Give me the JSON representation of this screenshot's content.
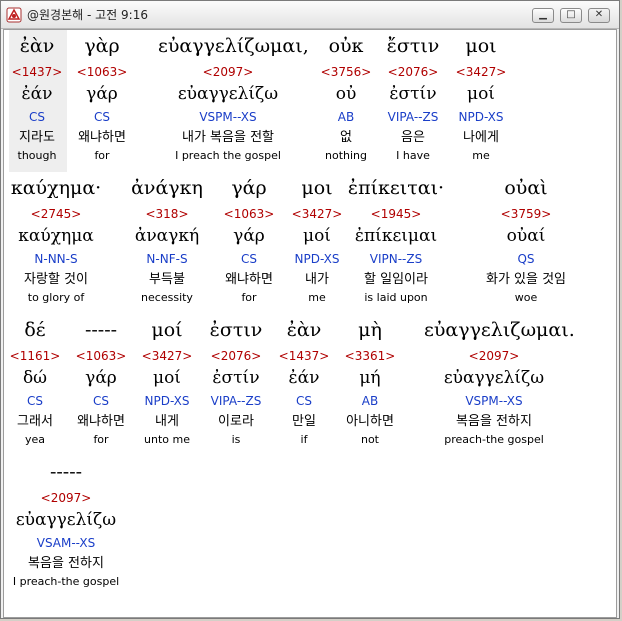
{
  "window": {
    "title": "@원경본해 - 고전 9:16",
    "minimize": "▁",
    "maximize": "□",
    "close": "✕"
  },
  "colors": {
    "strong": "#b00000",
    "morph": "#1a3ec8"
  },
  "rows": [
    [
      {
        "greek": "ἐὰν",
        "strong": "<1437>",
        "lemma": "ἐάν",
        "morph": "CS",
        "korean": "지라도",
        "english": "though"
      },
      {
        "greek": "γὰρ",
        "strong": "<1063>",
        "lemma": "γάρ",
        "morph": "CS",
        "korean": "왜냐하면",
        "english": "for"
      },
      {
        "greek": "εὐαγγελίζωμαι,",
        "strong": "<2097>",
        "lemma": "εὐαγγελίζω",
        "morph": "VSPM--XS",
        "korean": "내가 복음을 전할",
        "english": "I preach the gospel"
      },
      {
        "greek": "οὐκ",
        "strong": "<3756>",
        "lemma": "οὐ",
        "morph": "AB",
        "korean": "없",
        "english": "nothing"
      },
      {
        "greek": "ἔστιν",
        "strong": "<2076>",
        "lemma": "ἐστίν",
        "morph": "VIPA--ZS",
        "korean": "음은",
        "english": "I have"
      },
      {
        "greek": "μοι",
        "strong": "<3427>",
        "lemma": "μοί",
        "morph": "NPD-XS",
        "korean": "나에게",
        "english": "me"
      }
    ],
    [
      {
        "greek": "καύχημα·",
        "strong": "<2745>",
        "lemma": "καύχημα",
        "morph": "N-NN-S",
        "korean": "자랑할 것이",
        "english": "to glory of"
      },
      {
        "greek": "ἀνάγκη",
        "strong": "<318>",
        "lemma": "ἀναγκή",
        "morph": "N-NF-S",
        "korean": "부득불",
        "english": "necessity"
      },
      {
        "greek": "γάρ",
        "strong": "<1063>",
        "lemma": "γάρ",
        "morph": "CS",
        "korean": "왜냐하면",
        "english": "for"
      },
      {
        "greek": "μοι",
        "strong": "<3427>",
        "lemma": "μοί",
        "morph": "NPD-XS",
        "korean": "내가",
        "english": "me"
      },
      {
        "greek": "ἐπίκειται·",
        "strong": "<1945>",
        "lemma": "ἐπίκειμαι",
        "morph": "VIPN--ZS",
        "korean": "할 일임이라",
        "english": "is laid upon"
      },
      {
        "greek": "οὐαὶ",
        "strong": "<3759>",
        "lemma": "οὐαί",
        "morph": "QS",
        "korean": "화가 있을 것임",
        "english": "woe"
      }
    ],
    [
      {
        "greek": "δέ",
        "strong": "<1161>",
        "lemma": "δώ",
        "morph": "CS",
        "korean": "그래서",
        "english": "yea"
      },
      {
        "greek": "-----",
        "strong": "<1063>",
        "lemma": "γάρ",
        "morph": "CS",
        "korean": "왜냐하면",
        "english": "for"
      },
      {
        "greek": "μοί",
        "strong": "<3427>",
        "lemma": "μοί",
        "morph": "NPD-XS",
        "korean": "내게",
        "english": "unto me"
      },
      {
        "greek": "ἐστιν",
        "strong": "<2076>",
        "lemma": "ἐστίν",
        "morph": "VIPA--ZS",
        "korean": "이로라",
        "english": "is"
      },
      {
        "greek": "ἐὰν",
        "strong": "<1437>",
        "lemma": "ἐάν",
        "morph": "CS",
        "korean": "만일",
        "english": "if"
      },
      {
        "greek": "μὴ",
        "strong": "<3361>",
        "lemma": "μή",
        "morph": "AB",
        "korean": "아니하면",
        "english": "not"
      },
      {
        "greek": "εὐαγγελιζωμαι.",
        "strong": "<2097>",
        "lemma": "εὐαγγελίζω",
        "morph": "VSPM--XS",
        "korean": "복음을 전하지",
        "english": "preach-the gospel"
      }
    ],
    [
      {
        "greek": "-----",
        "strong": "<2097>",
        "lemma": "εὐαγγελίζω",
        "morph": "VSAM--XS",
        "korean": "복음을 전하지",
        "english": "I preach-the gospel"
      }
    ]
  ]
}
